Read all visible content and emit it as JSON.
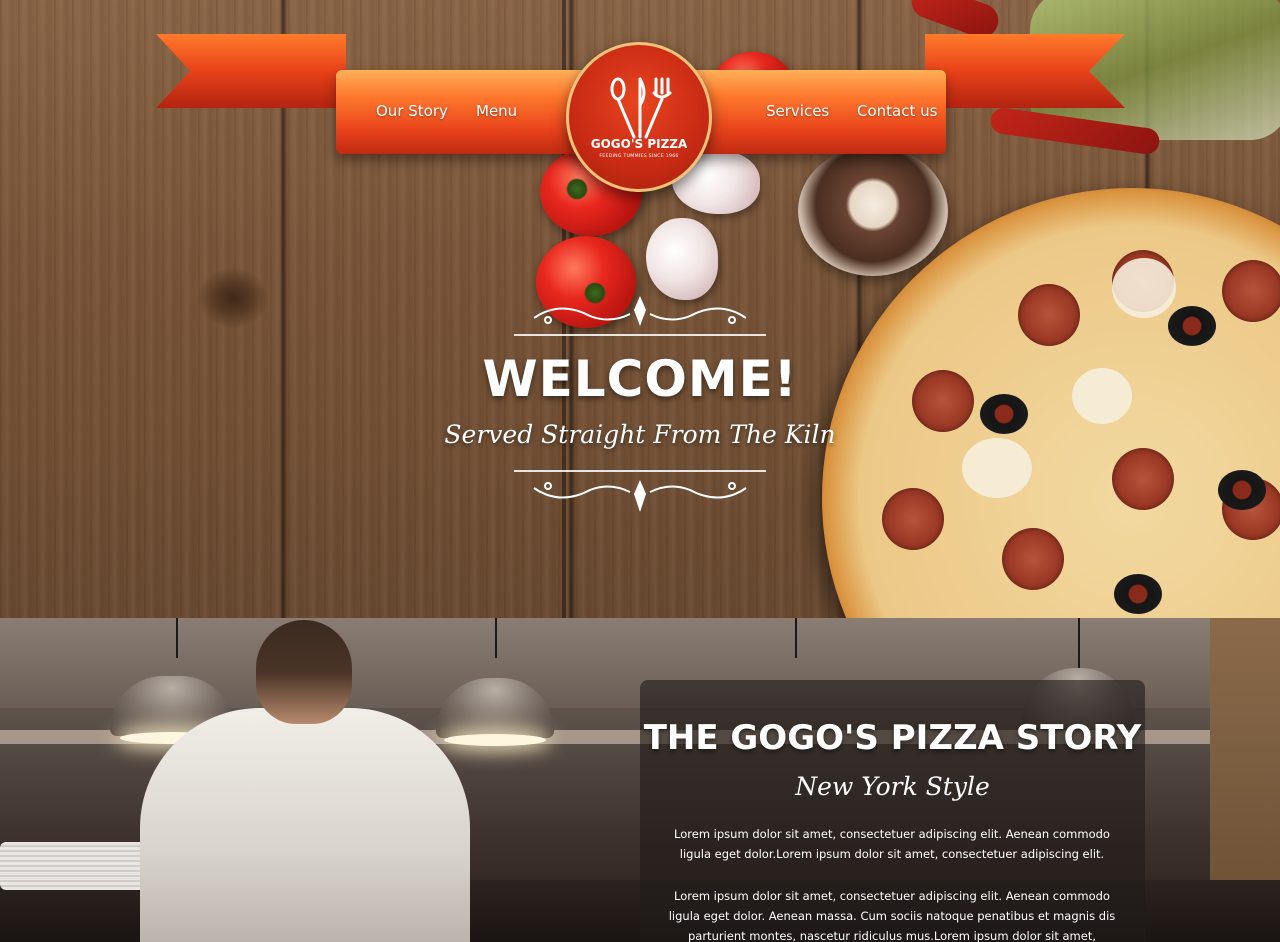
{
  "nav": {
    "left": [
      "Our Story",
      "Menu"
    ],
    "right": [
      "Services",
      "Contact us"
    ]
  },
  "logo": {
    "name": "GOGO'S PIZZA",
    "tagline": "FEEDING TUMMIES SINCE 1966",
    "icon": "fork-spoon-knife-icon"
  },
  "hero": {
    "title": "WELCOME!",
    "tagline": "Served Straight From The Kiln"
  },
  "story": {
    "title": "THE GOGO'S PIZZA STORY",
    "subtitle": "New York Style",
    "paragraphs": [
      "Lorem ipsum dolor sit amet, consectetuer adipiscing elit. Aenean commodo ligula eget dolor.Lorem ipsum dolor sit amet, consectetuer adipiscing elit.",
      "Lorem ipsum dolor sit amet, consectetuer adipiscing elit. Aenean commodo ligula eget dolor. Aenean massa. Cum sociis natoque penatibus et magnis dis parturient montes, nascetur ridiculus mus.Lorem ipsum dolor sit amet,"
    ]
  },
  "colors": {
    "ribbon": "#e9451c",
    "logo_red": "#c82a14",
    "logo_border": "#f3c17a",
    "wood": "#7a5639"
  }
}
